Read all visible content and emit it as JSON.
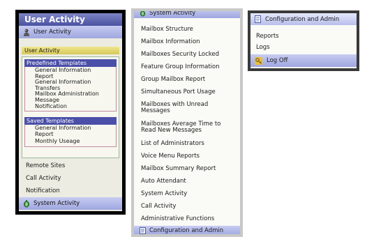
{
  "panel1": {
    "title": "User Activity",
    "header": "User Activity",
    "section_label": "User Activity",
    "predefined": {
      "heading": "Predefined Templates",
      "items": [
        "General Information\nReport",
        "General Information\nTransfers",
        "Mailbox Administration",
        "Message\nNotification"
      ]
    },
    "saved": {
      "heading": "Saved Templates",
      "items": [
        "General Information\nReport",
        "Monthly Useage"
      ]
    },
    "links": [
      "Remote Sites",
      "Call Activity",
      "Notification"
    ],
    "footer": "System Activity"
  },
  "panel2": {
    "header": "System Activity",
    "items": [
      "Mailbox Structure",
      "Mailbox Information",
      "Mailboxes Security Locked",
      "Feature Group Information",
      "Group Mailbox Report",
      "Simultaneous Port Usage",
      "Mailboxes with Unread\nMessages",
      "Mailboxes Average Time to\nRead New Messages",
      "List of Administrators",
      "Voice Menu Reports",
      "Mailbox Summary Report",
      "Auto Attendant",
      "System Activity",
      "Call Activity",
      "Administrative Functions"
    ],
    "footer": "Configuration and Admin"
  },
  "panel3": {
    "header": "Configuration and Admin",
    "items": [
      "Reports",
      "Logs"
    ],
    "logoff": "Log Off"
  },
  "icons": {
    "user_activity": "user-activity-icon",
    "system_activity": "system-activity-icon",
    "config_admin": "document-icon",
    "logoff": "key-icon"
  },
  "colors": {
    "title_bar": "#4a52a2",
    "header_bar": "#9ea6e0",
    "group_heading": "#4b4fa8",
    "highlight": "#d6c85a",
    "panel_bg": "#ecece2"
  }
}
